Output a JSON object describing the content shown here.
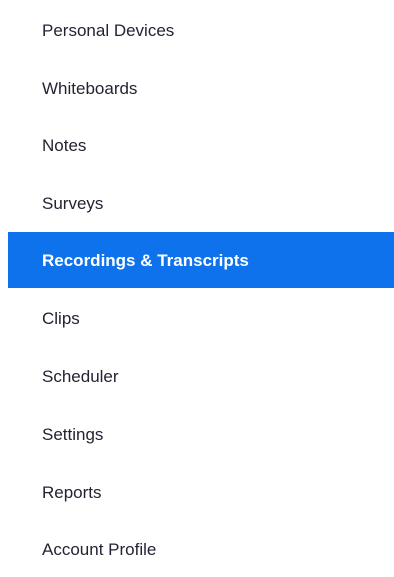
{
  "sidebar": {
    "accent_color": "#0e72ed",
    "text_color": "#232333",
    "active_text_color": "#ffffff",
    "items": [
      {
        "label": "Personal Devices"
      },
      {
        "label": "Whiteboards"
      },
      {
        "label": "Notes"
      },
      {
        "label": "Surveys"
      },
      {
        "label": "Recordings & Transcripts",
        "active": true
      },
      {
        "label": "Clips"
      },
      {
        "label": "Scheduler"
      },
      {
        "label": "Settings"
      },
      {
        "label": "Reports"
      },
      {
        "label": "Account Profile"
      }
    ]
  }
}
